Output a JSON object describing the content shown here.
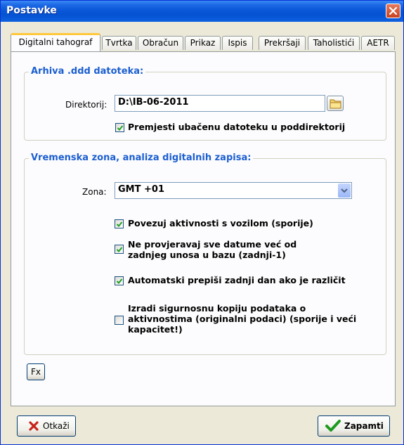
{
  "window": {
    "title": "Postavke"
  },
  "tabs": [
    {
      "label": "Digitalni tahograf",
      "active": true
    },
    {
      "label": "Tvrtka"
    },
    {
      "label": "Obračun"
    },
    {
      "label": "Prikaz"
    },
    {
      "label": "Ispis"
    },
    {
      "label": "Prekršaji"
    },
    {
      "label": "Taholistići"
    },
    {
      "label": "AETR"
    }
  ],
  "archive": {
    "title": "Arhiva .ddd datoteka:",
    "dir_label": "Direktorij:",
    "dir_value": "D:\\IB-06-2011",
    "move_file_label": "Premjesti ubačenu datoteku u poddirektorij",
    "move_file_checked": true
  },
  "timezone": {
    "title": "Vremenska zona, analiza digitalnih zapisa:",
    "zone_label": "Zona:",
    "zone_value": "GMT +01",
    "options": [
      {
        "label": "Povezuj aktivnosti s vozilom (sporije)",
        "checked": true
      },
      {
        "label": "Ne provjeravaj sve datume već od zadnjeg unosa u bazu (zadnji-1)",
        "line1": "Ne provjeravaj sve datume već od",
        "line2": "zadnjeg unosa u bazu (zadnji-1)",
        "checked": true
      },
      {
        "label": "Automatski prepiši zadnji dan ako je različit",
        "checked": true
      },
      {
        "label": "Izradi sigurnosnu kopiju podataka o aktivnostima (originalni podaci) (sporije i veći kapacitet!)",
        "line1": "Izradi sigurnosnu kopiju podataka o",
        "line2": "aktivnostima (originalni podaci) (sporije i veći",
        "line3": "kapacitet!)",
        "checked": false
      }
    ]
  },
  "fx_button": "Fx",
  "buttons": {
    "cancel": "Otkaži",
    "save": "Zapamti"
  },
  "colors": {
    "title_bar": "#0a58d8",
    "group_title": "#1c5fd0",
    "active_tab_accent": "#ffc83c"
  }
}
